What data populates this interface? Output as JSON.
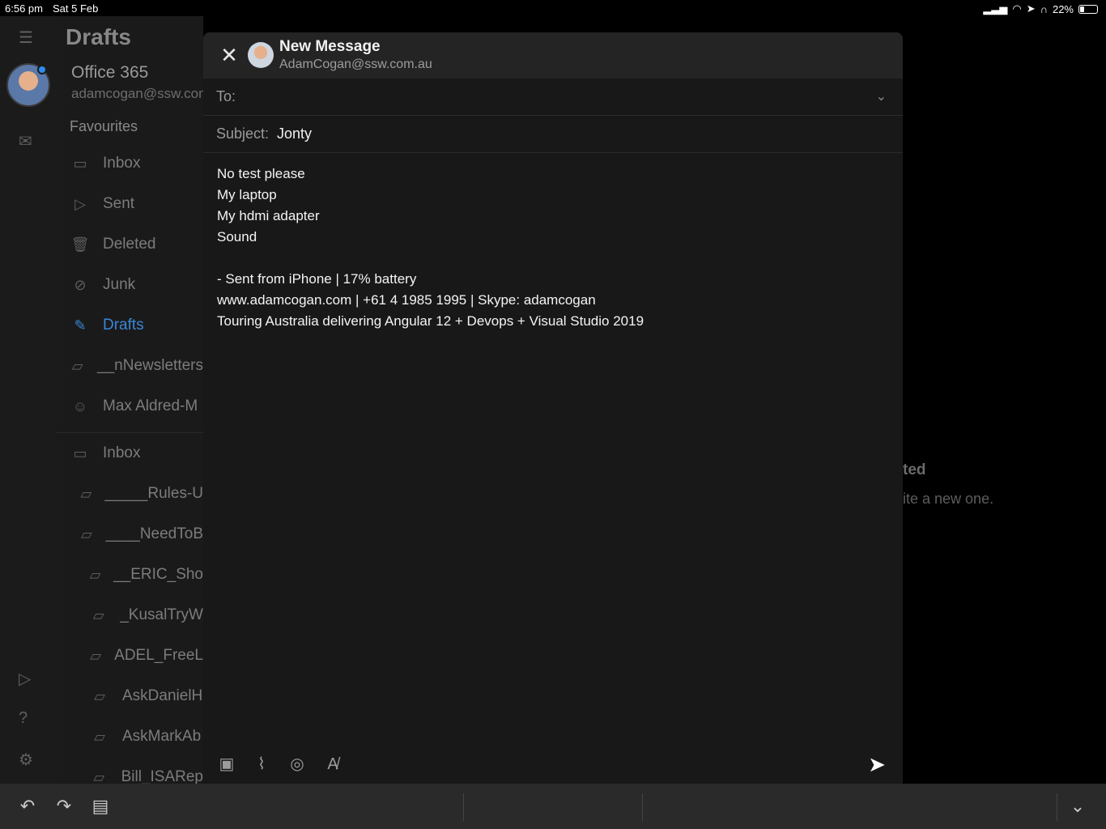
{
  "status_bar": {
    "time": "6:56 pm",
    "date": "Sat 5 Feb",
    "battery": "22%"
  },
  "folder_pane": {
    "title": "Drafts",
    "account_name": "Office 365",
    "account_email": "adamcogan@ssw.com.au",
    "favourites_label": "Favourites",
    "favourites": [
      {
        "label": "Inbox",
        "icon": "inbox-icon"
      },
      {
        "label": "Sent",
        "icon": "send-icon"
      },
      {
        "label": "Deleted",
        "icon": "trash-icon"
      },
      {
        "label": "Junk",
        "icon": "junk-icon"
      },
      {
        "label": "Drafts",
        "icon": "pencil-icon",
        "active": true
      },
      {
        "label": "__nNewsletters",
        "icon": "folder-icon"
      },
      {
        "label": "Max Aldred-M",
        "icon": "person-icon"
      }
    ],
    "folders": [
      {
        "label": "Inbox",
        "icon": "inbox-icon"
      },
      {
        "label": "_____Rules-U",
        "icon": "folder-icon"
      },
      {
        "label": "____NeedToB",
        "icon": "folder-icon"
      },
      {
        "label": "__ERIC_Sho",
        "icon": "folder-icon"
      },
      {
        "label": "_KusalTryW",
        "icon": "folder-icon"
      },
      {
        "label": "ADEL_FreeL",
        "icon": "folder-icon"
      },
      {
        "label": "AskDanielH",
        "icon": "folder-icon"
      },
      {
        "label": "AskMarkAb",
        "icon": "folder-icon"
      },
      {
        "label": "Bill_ISARep",
        "icon": "folder-icon"
      }
    ]
  },
  "background_pane": {
    "hint_title": "ted",
    "hint_body": "ite a new one."
  },
  "compose": {
    "title": "New Message",
    "from": "AdamCogan@ssw.com.au",
    "to_label": "To:",
    "to_value": "",
    "subject_label": "Subject:",
    "subject_value": "Jonty",
    "body_lines": [
      "No test please",
      "My laptop",
      "My hdmi adapter",
      "Sound",
      "",
      "- Sent from iPhone  |  17% battery",
      "www.adamcogan.com  |  +61 4 1985 1995  |  Skype: adamcogan",
      "Touring Australia delivering Angular 12 + Devops + Visual Studio 2019"
    ],
    "toolbar_icons": [
      "calendar-add-icon",
      "paperclip-icon",
      "camera-icon",
      "format-text-icon"
    ]
  },
  "colors": {
    "accent": "#3a86d6",
    "background": "#000000",
    "compose_bg": "#181818",
    "header_bg": "#242424"
  }
}
